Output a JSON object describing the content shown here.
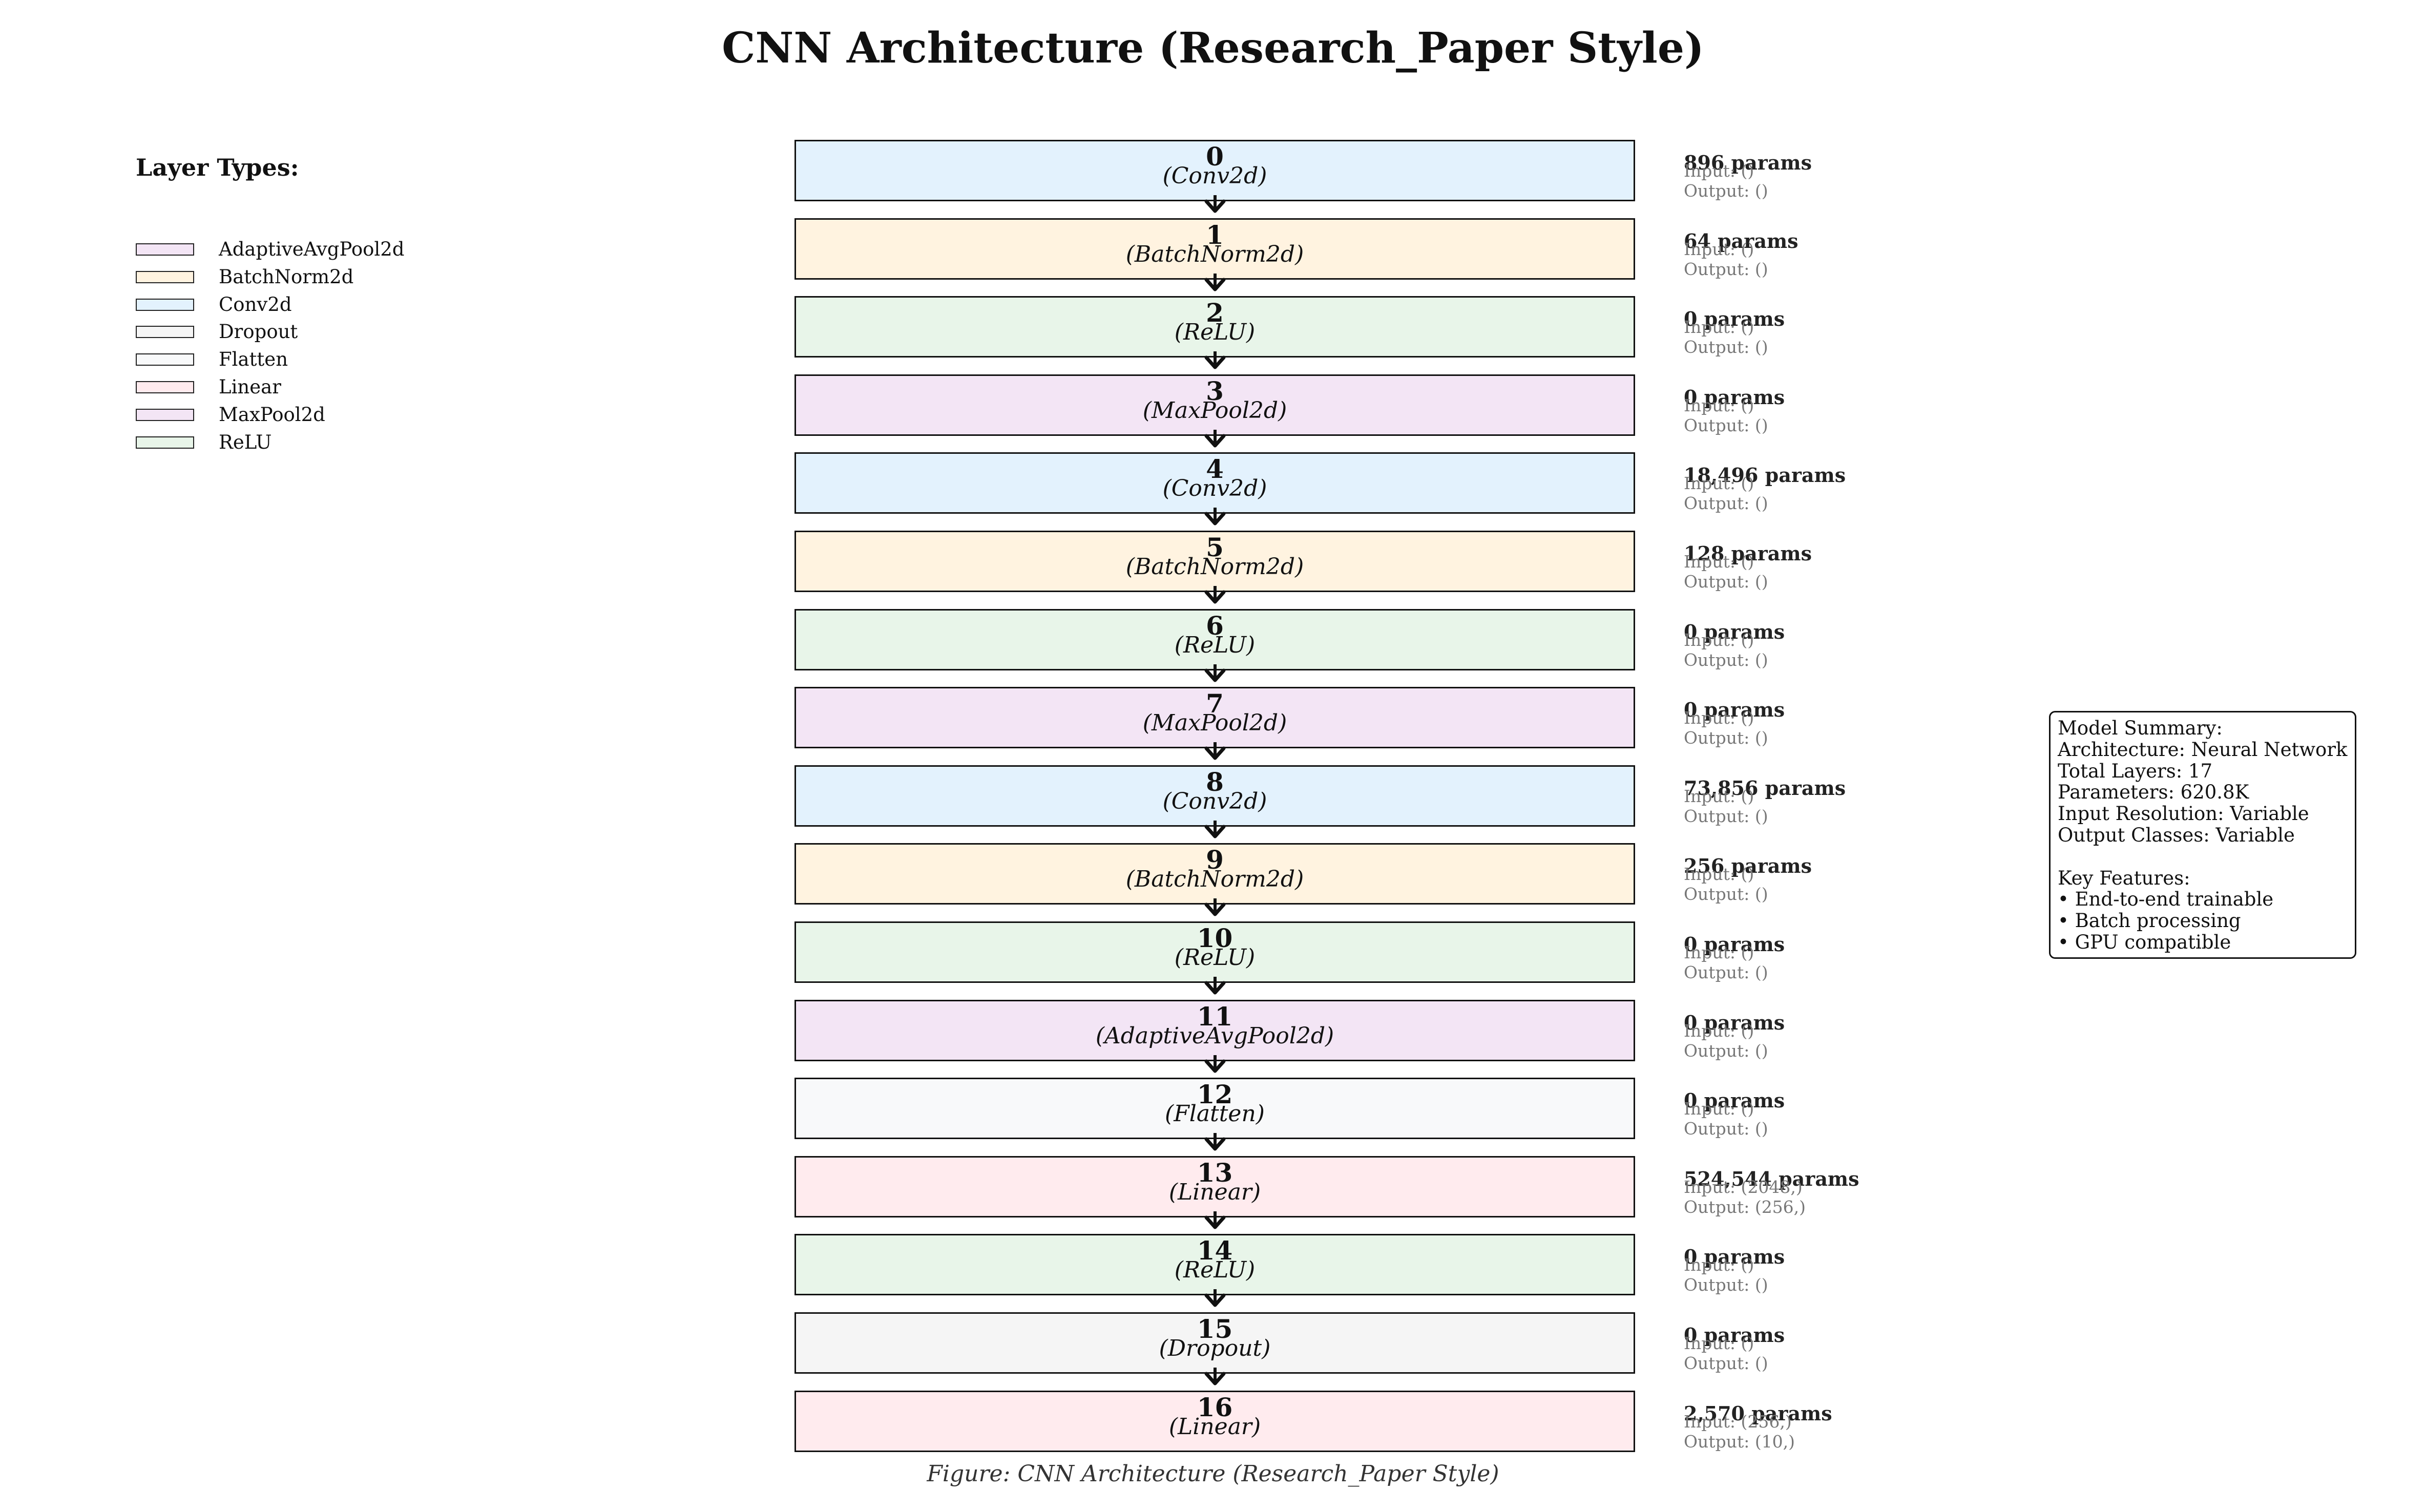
{
  "title": "CNN Architecture (Research_Paper Style)",
  "caption": "Figure: CNN Architecture (Research_Paper Style)",
  "legend": {
    "title": "Layer Types:",
    "items": [
      {
        "label": "AdaptiveAvgPool2d",
        "color": "#f3e5f5"
      },
      {
        "label": "BatchNorm2d",
        "color": "#fff3e0"
      },
      {
        "label": "Conv2d",
        "color": "#e3f2fd"
      },
      {
        "label": "Dropout",
        "color": "#f5f5f5"
      },
      {
        "label": "Flatten",
        "color": "#f8f9fa"
      },
      {
        "label": "Linear",
        "color": "#ffebee"
      },
      {
        "label": "MaxPool2d",
        "color": "#f3e5f5"
      },
      {
        "label": "ReLU",
        "color": "#e8f5e9"
      }
    ]
  },
  "layers": [
    {
      "index": "0",
      "type": "(Conv2d)",
      "params": "896 params",
      "input": "Input: ()",
      "output": "Output: ()",
      "color": "#e3f2fd"
    },
    {
      "index": "1",
      "type": "(BatchNorm2d)",
      "params": "64 params",
      "input": "Input: ()",
      "output": "Output: ()",
      "color": "#fff3e0"
    },
    {
      "index": "2",
      "type": "(ReLU)",
      "params": "0 params",
      "input": "Input: ()",
      "output": "Output: ()",
      "color": "#e8f5e9"
    },
    {
      "index": "3",
      "type": "(MaxPool2d)",
      "params": "0 params",
      "input": "Input: ()",
      "output": "Output: ()",
      "color": "#f3e5f5"
    },
    {
      "index": "4",
      "type": "(Conv2d)",
      "params": "18,496 params",
      "input": "Input: ()",
      "output": "Output: ()",
      "color": "#e3f2fd"
    },
    {
      "index": "5",
      "type": "(BatchNorm2d)",
      "params": "128 params",
      "input": "Input: ()",
      "output": "Output: ()",
      "color": "#fff3e0"
    },
    {
      "index": "6",
      "type": "(ReLU)",
      "params": "0 params",
      "input": "Input: ()",
      "output": "Output: ()",
      "color": "#e8f5e9"
    },
    {
      "index": "7",
      "type": "(MaxPool2d)",
      "params": "0 params",
      "input": "Input: ()",
      "output": "Output: ()",
      "color": "#f3e5f5"
    },
    {
      "index": "8",
      "type": "(Conv2d)",
      "params": "73,856 params",
      "input": "Input: ()",
      "output": "Output: ()",
      "color": "#e3f2fd"
    },
    {
      "index": "9",
      "type": "(BatchNorm2d)",
      "params": "256 params",
      "input": "Input: ()",
      "output": "Output: ()",
      "color": "#fff3e0"
    },
    {
      "index": "10",
      "type": "(ReLU)",
      "params": "0 params",
      "input": "Input: ()",
      "output": "Output: ()",
      "color": "#e8f5e9"
    },
    {
      "index": "11",
      "type": "(AdaptiveAvgPool2d)",
      "params": "0 params",
      "input": "Input: ()",
      "output": "Output: ()",
      "color": "#f3e5f5"
    },
    {
      "index": "12",
      "type": "(Flatten)",
      "params": "0 params",
      "input": "Input: ()",
      "output": "Output: ()",
      "color": "#f8f9fa"
    },
    {
      "index": "13",
      "type": "(Linear)",
      "params": "524,544 params",
      "input": "Input: (2048,)",
      "output": "Output: (256,)",
      "color": "#ffebee"
    },
    {
      "index": "14",
      "type": "(ReLU)",
      "params": "0 params",
      "input": "Input: ()",
      "output": "Output: ()",
      "color": "#e8f5e9"
    },
    {
      "index": "15",
      "type": "(Dropout)",
      "params": "0 params",
      "input": "Input: ()",
      "output": "Output: ()",
      "color": "#f5f5f5"
    },
    {
      "index": "16",
      "type": "(Linear)",
      "params": "2,570 params",
      "input": "Input: (256,)",
      "output": "Output: (10,)",
      "color": "#ffebee"
    }
  ],
  "summary": {
    "lines": [
      "Model Summary:",
      "Architecture: Neural Network",
      "Total Layers: 17",
      "Parameters: 620.8K",
      "Input Resolution: Variable",
      "Output Classes: Variable",
      "",
      "Key Features:",
      "• End-to-end trainable",
      "• Batch processing",
      "• GPU compatible"
    ]
  }
}
